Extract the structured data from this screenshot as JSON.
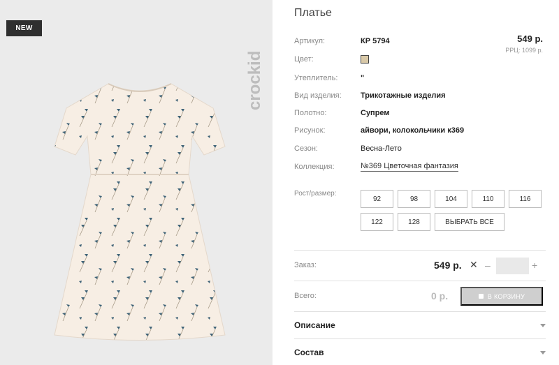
{
  "badge": {
    "label": "NEW"
  },
  "brand": {
    "name": "crockid"
  },
  "product": {
    "title": "Платье",
    "price": "549 р.",
    "rrp": "РРЦ: 1099 р."
  },
  "attributes": [
    {
      "label": "Артикул:",
      "value": "КР 5794"
    },
    {
      "label": "Цвет:",
      "value": ""
    },
    {
      "label": "Утеплитель:",
      "value": "\""
    },
    {
      "label": "Вид изделия:",
      "value": "Трикотажные изделия"
    },
    {
      "label": "Полотно:",
      "value": "Супрем"
    },
    {
      "label": "Рисунок:",
      "value": "айвори, колокольчики к369"
    },
    {
      "label": "Сезон:",
      "value": "Весна-Лето"
    },
    {
      "label": "Коллекция:",
      "value": "№369 Цветочная фантазия"
    }
  ],
  "color_swatch": "#d9c9a8",
  "sizes": {
    "label": "Рост/размер:",
    "options": [
      "92",
      "98",
      "104",
      "110",
      "116",
      "122",
      "128"
    ],
    "select_all": "ВЫБРАТЬ ВСЕ"
  },
  "order": {
    "label": "Заказ:",
    "price": "549 р.",
    "times": "✕",
    "minus": "–",
    "quantity": "",
    "plus": "+"
  },
  "total": {
    "label": "Всего:",
    "value": "0 р.",
    "cart_button": "В КОРЗИНУ"
  },
  "accordions": {
    "description": "Описание",
    "composition": "Состав"
  },
  "icons": {
    "close": "times-icon",
    "chevron": "chevron-down-icon",
    "cart": "cart-icon"
  }
}
